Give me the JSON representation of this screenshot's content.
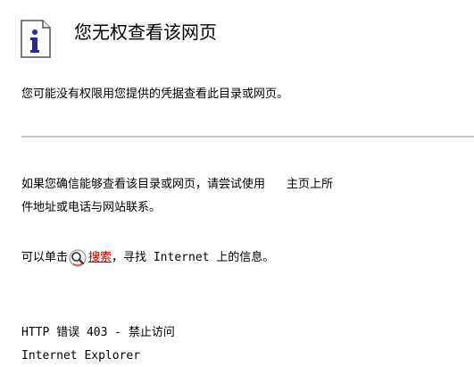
{
  "header": {
    "title": "您无权查看该网页",
    "icon": "info-icon"
  },
  "subtitle": "您可能没有权限用您提供的凭据查看此目录或网页。",
  "body": {
    "paragraph_line1": "如果您确信能够查看该目录或网页，请尝试使用",
    "paragraph_line1_tail": "主页上所",
    "paragraph_line2": "件地址或电话与网站联系。",
    "search_prefix": "可以单击",
    "search_icon": "search-magnifier-icon",
    "search_link": "搜索",
    "search_suffix": "，寻找 Internet 上的信息。"
  },
  "footer": {
    "error_line": "HTTP 错误 403 - 禁止访问",
    "browser": "Internet Explorer"
  },
  "colors": {
    "link": "#cc0000",
    "icon_i": "#2a2a8c",
    "divider": "#c8c8c8"
  }
}
